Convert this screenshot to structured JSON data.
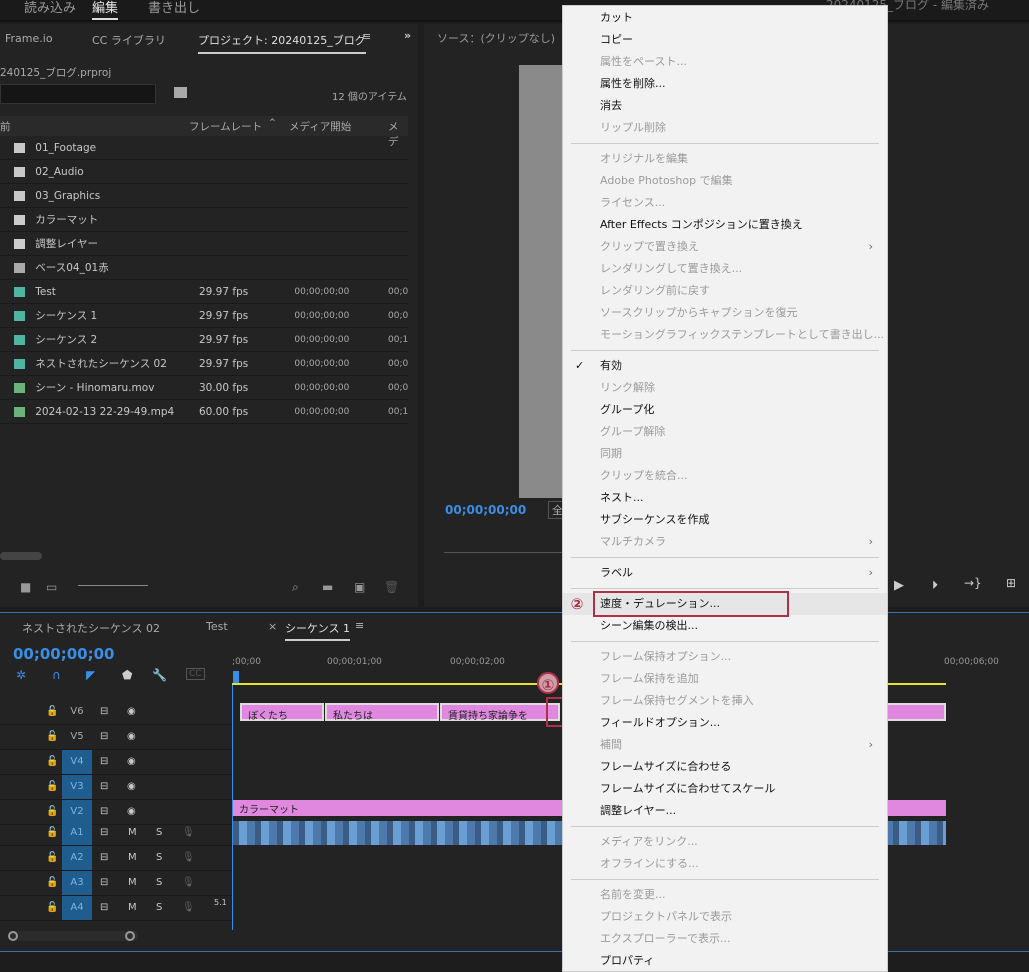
{
  "workspace_tabs": [
    "読み込み",
    "編集",
    "書き出し"
  ],
  "app_title": "20240125_ブログ - 編集済み",
  "project_panel": {
    "tabs": [
      "Frame.io",
      "CC ライブラリ",
      "プロジェクト: 20240125_ブログ"
    ],
    "file": "240125_ブログ.prproj",
    "item_count": "12 個のアイテム",
    "columns": [
      "前",
      "フレームレート",
      "メディア開始",
      "メデ"
    ],
    "rows": [
      {
        "name": "01_Footage",
        "icon": "folder-icon",
        "fps": "",
        "start": "",
        "end": ""
      },
      {
        "name": "02_Audio",
        "icon": "folder-icon",
        "fps": "",
        "start": "",
        "end": ""
      },
      {
        "name": "03_Graphics",
        "icon": "folder-icon",
        "fps": "",
        "start": "",
        "end": ""
      },
      {
        "name": "カラーマット",
        "icon": "color-matte-icon",
        "fps": "",
        "start": "",
        "end": ""
      },
      {
        "name": "調整レイヤー",
        "icon": "adjustment-layer-icon",
        "fps": "",
        "start": "",
        "end": ""
      },
      {
        "name": "ベース04_01赤",
        "icon": "premiere-file-icon",
        "fps": "",
        "start": "",
        "end": ""
      },
      {
        "name": "Test",
        "icon": "sequence-icon",
        "fps": "29.97 fps",
        "start": "00;00;00;00",
        "end": "00;0"
      },
      {
        "name": "シーケンス 1",
        "icon": "sequence-icon",
        "fps": "29.97 fps",
        "start": "00;00;00;00",
        "end": "00;0"
      },
      {
        "name": "シーケンス 2",
        "icon": "sequence-icon",
        "fps": "29.97 fps",
        "start": "00;00;00;00",
        "end": "00;1"
      },
      {
        "name": "ネストされたシーケンス 02",
        "icon": "sequence-icon",
        "fps": "29.97 fps",
        "start": "00;00;00;00",
        "end": "00;0"
      },
      {
        "name": "シーン - Hinomaru.mov",
        "icon": "video-clip-icon",
        "fps": "30.00 fps",
        "start": "00;00;00;00",
        "end": "00;0"
      },
      {
        "name": "2024-02-13 22-29-49.mp4",
        "icon": "video-clip-icon",
        "fps": "60.00 fps",
        "start": "00;00;00;00",
        "end": "00;1"
      }
    ]
  },
  "source": {
    "title": "ソース：(クリップなし)",
    "timecode": "00;00;00;00",
    "fit": "全"
  },
  "timeline": {
    "tabs": [
      "ネストされたシーケンス 02",
      "Test",
      "シーケンス 1"
    ],
    "timecode": "00;00;00;00",
    "ruler": [
      ";00;00",
      "00;00;01;00",
      "00;00;02;00",
      "00;00;06;00"
    ],
    "tracks": [
      "V6",
      "V5",
      "V4",
      "V3",
      "V2",
      "A1",
      "A2",
      "A3",
      "A4"
    ],
    "audio_labels": {
      "m": "M",
      "s": "S",
      "ch": "5.1"
    },
    "v6_clips": [
      "ぼくたち",
      "私たちは",
      "賃貸持ち家論争を"
    ],
    "v2_clip": "カラーマット"
  },
  "annotations": {
    "step1": "①",
    "step2": "②"
  },
  "context_menu": [
    {
      "label": "カット"
    },
    {
      "label": "コピー"
    },
    {
      "label": "属性をペースト...",
      "disabled": true
    },
    {
      "label": "属性を削除..."
    },
    {
      "label": "消去"
    },
    {
      "label": "リップル削除",
      "disabled": true
    },
    {
      "sep": true
    },
    {
      "label": "オリジナルを編集",
      "disabled": true
    },
    {
      "label": "Adobe Photoshop で編集",
      "disabled": true
    },
    {
      "label": "ライセンス...",
      "disabled": true
    },
    {
      "label": "After Effects コンポジションに置き換え"
    },
    {
      "label": "クリップで置き換え",
      "disabled": true,
      "submenu": true
    },
    {
      "label": "レンダリングして置き換え...",
      "disabled": true
    },
    {
      "label": "レンダリング前に戻す",
      "disabled": true
    },
    {
      "label": "ソースクリップからキャプションを復元",
      "disabled": true
    },
    {
      "label": "モーショングラフィックステンプレートとして書き出し...",
      "disabled": true
    },
    {
      "sep": true
    },
    {
      "label": "有効",
      "checked": true
    },
    {
      "label": "リンク解除",
      "disabled": true
    },
    {
      "label": "グループ化"
    },
    {
      "label": "グループ解除",
      "disabled": true
    },
    {
      "label": "同期",
      "disabled": true
    },
    {
      "label": "クリップを統合...",
      "disabled": true
    },
    {
      "label": "ネスト..."
    },
    {
      "label": "サブシーケンスを作成"
    },
    {
      "label": "マルチカメラ",
      "disabled": true,
      "submenu": true
    },
    {
      "sep": true
    },
    {
      "label": "ラベル",
      "submenu": true
    },
    {
      "sep": true
    },
    {
      "label": "速度・デュレーション...",
      "hover": true,
      "highlight": true
    },
    {
      "label": "シーン編集の検出..."
    },
    {
      "sep": true
    },
    {
      "label": "フレーム保持オプション...",
      "disabled": true
    },
    {
      "label": "フレーム保持を追加",
      "disabled": true
    },
    {
      "label": "フレーム保持セグメントを挿入",
      "disabled": true
    },
    {
      "label": "フィールドオプション..."
    },
    {
      "label": "補間",
      "disabled": true,
      "submenu": true
    },
    {
      "label": "フレームサイズに合わせる"
    },
    {
      "label": "フレームサイズに合わせてスケール"
    },
    {
      "label": "調整レイヤー..."
    },
    {
      "sep": true
    },
    {
      "label": "メディアをリンク...",
      "disabled": true
    },
    {
      "label": "オフラインにする...",
      "disabled": true
    },
    {
      "sep": true
    },
    {
      "label": "名前を変更...",
      "disabled": true
    },
    {
      "label": "プロジェクトパネルで表示",
      "disabled": true
    },
    {
      "label": "エクスプローラーで表示...",
      "disabled": true
    },
    {
      "label": "プロパティ"
    }
  ],
  "colors": {
    "accent": "#3a8ee6",
    "clip_pink": "#e088e0",
    "annotation_red": "#b0304a",
    "audio_wave": "#6a9fd6"
  }
}
